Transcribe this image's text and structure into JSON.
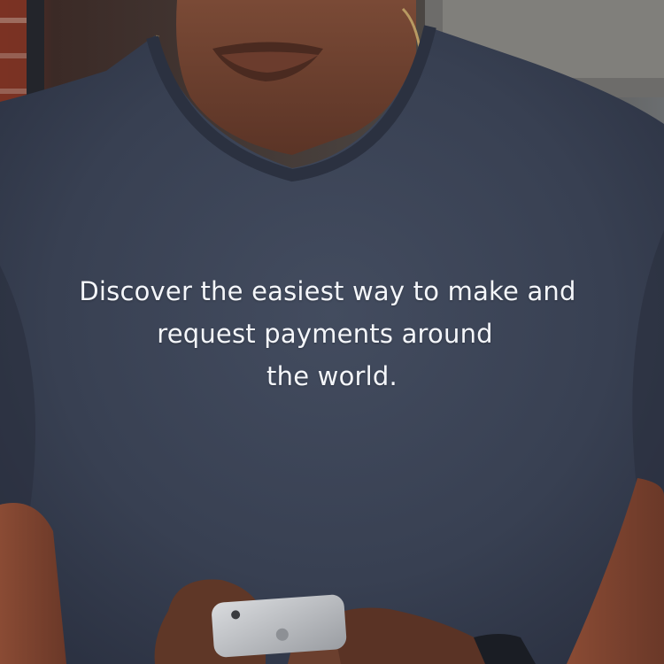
{
  "hero": {
    "headline_line1": "Discover the easiest way to make and",
    "headline_line2": "request payments around",
    "headline_line3": "the world."
  },
  "image": {
    "subject": "person-in-gray-tshirt-holding-smartphone",
    "tshirt_color": "#3a4253",
    "skin_color": "#6e4636",
    "background_wall_color": "#4f4a46",
    "phone_color": "#b9bcc1",
    "watch_color": "#1a1d24"
  }
}
